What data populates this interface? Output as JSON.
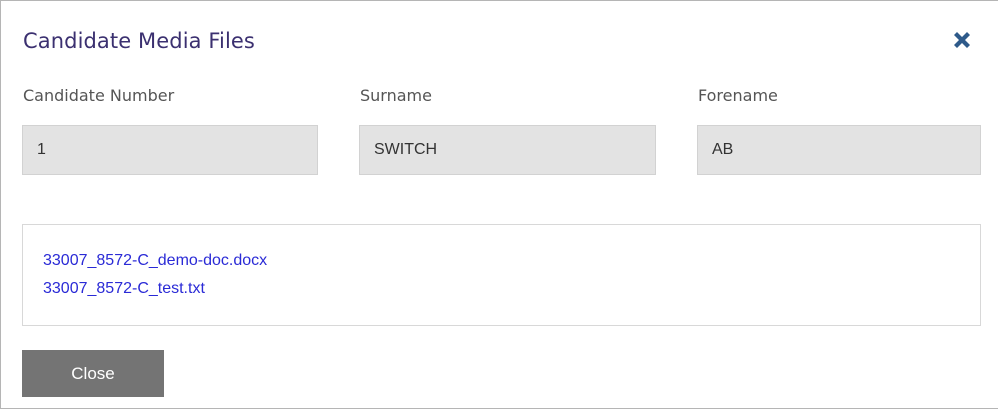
{
  "dialog": {
    "title": "Candidate Media Files",
    "close_icon": "close-x-icon"
  },
  "fields": {
    "candidate_number": {
      "label": "Candidate Number",
      "value": "1"
    },
    "surname": {
      "label": "Surname",
      "value": "SWITCH"
    },
    "forename": {
      "label": "Forename",
      "value": "AB"
    }
  },
  "files": [
    "33007_8572-C_demo-doc.docx",
    "33007_8572-C_test.txt"
  ],
  "footer": {
    "close_label": "Close"
  },
  "colors": {
    "title": "#3b3070",
    "close_icon": "#2e5a8a",
    "link": "#2a2ad6",
    "field_bg": "#e3e3e3",
    "button_bg": "#747474"
  }
}
